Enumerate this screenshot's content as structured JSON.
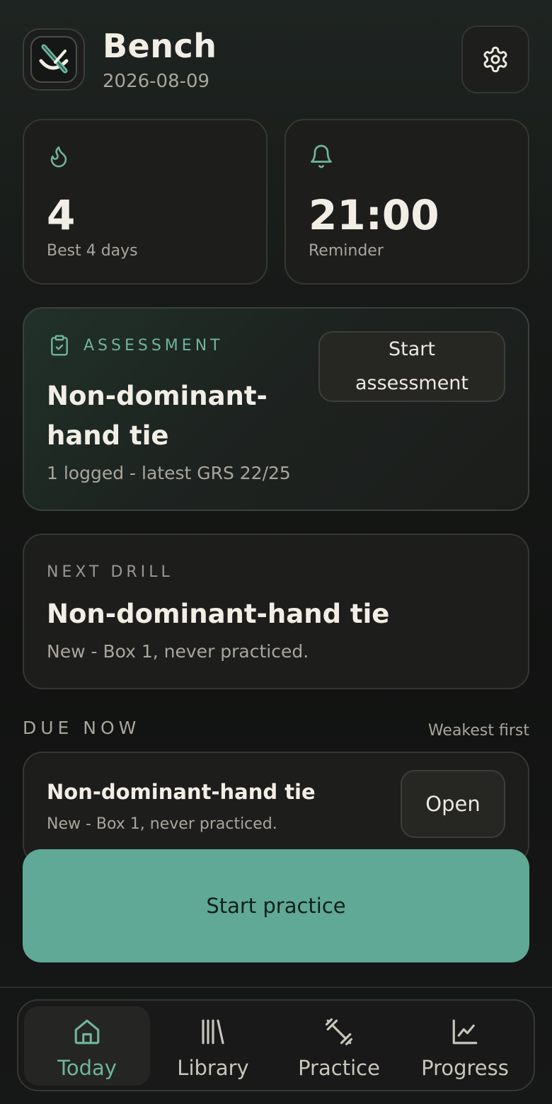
{
  "header": {
    "title": "Bench",
    "date": "2026-08-09",
    "app_icon": "suture-needle-icon",
    "settings_icon": "gear-icon"
  },
  "stats": {
    "streak": {
      "icon": "flame-icon",
      "value": "4",
      "label": "Best 4 days"
    },
    "reminder": {
      "icon": "bell-icon",
      "value": "21:00",
      "label": "Reminder"
    }
  },
  "assessment": {
    "icon": "clipboard-check-icon",
    "eyebrow": "ASSESSMENT",
    "title_line1": "Non-dominant-",
    "title_line2": "hand tie",
    "subtitle": "1 logged - latest GRS 22/25",
    "button_line1": "Start",
    "button_line2": "assessment"
  },
  "next_drill": {
    "eyebrow": "NEXT DRILL",
    "title": "Non-dominant-hand tie",
    "subtitle": "New - Box 1, never practiced."
  },
  "due_now": {
    "heading": "DUE NOW",
    "sort_label": "Weakest first",
    "items": [
      {
        "title": "Non-dominant-hand tie",
        "subtitle": "New - Box 1, never practiced.",
        "button": "Open"
      }
    ]
  },
  "practice_button": "Start practice",
  "nav": {
    "items": [
      {
        "label": "Today",
        "icon": "home-icon",
        "active": true
      },
      {
        "label": "Library",
        "icon": "library-icon",
        "active": false
      },
      {
        "label": "Practice",
        "icon": "dumbbell-icon",
        "active": false
      },
      {
        "label": "Progress",
        "icon": "chart-line-icon",
        "active": false
      }
    ]
  },
  "colors": {
    "accent": "#6fb39e",
    "primary_button": "#5fa996",
    "background": "#121312",
    "card": "#1d1e1c",
    "text": "#ece8df",
    "muted_text": "#a9a59c"
  }
}
